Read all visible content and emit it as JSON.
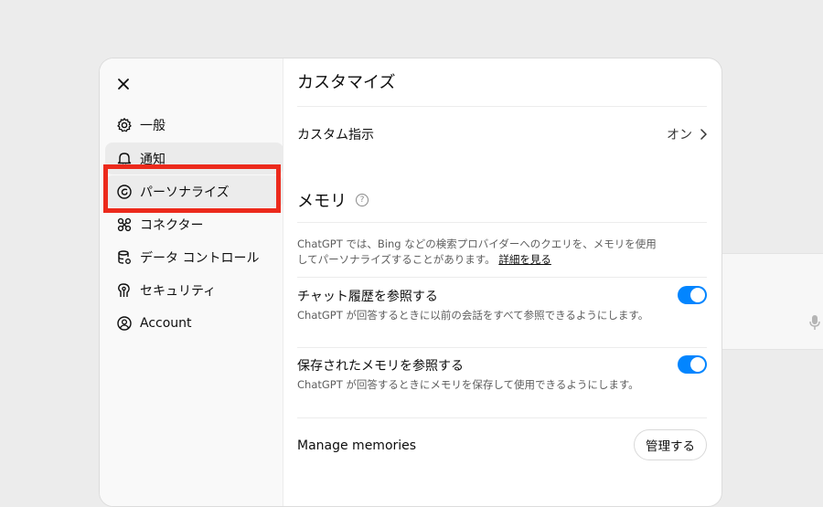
{
  "sidebar": {
    "items": [
      {
        "label": "一般",
        "icon": "gear-icon"
      },
      {
        "label": "通知",
        "icon": "bell-icon"
      },
      {
        "label": "パーソナライズ",
        "icon": "personalize-icon"
      },
      {
        "label": "コネクター",
        "icon": "connector-icon"
      },
      {
        "label": "データ コントロール",
        "icon": "database-icon"
      },
      {
        "label": "セキュリティ",
        "icon": "security-icon"
      },
      {
        "label": "Account",
        "icon": "account-icon"
      }
    ],
    "active_index": 2
  },
  "main": {
    "title": "カスタマイズ",
    "custom_instructions": {
      "label": "カスタム指示",
      "value": "オン"
    },
    "memory": {
      "title": "メモリ",
      "help": "?",
      "description": "ChatGPT では、Bing などの検索プロバイダーへのクエリを、メモリを使用してパーソナライズすることがあります。",
      "learn_more": "詳細を見る",
      "chat_history": {
        "label": "チャット履歴を参照する",
        "description": "ChatGPT が回答するときに以前の会話をすべて参照できるようにします。",
        "enabled": true
      },
      "saved_memory": {
        "label": "保存されたメモリを参照する",
        "description": "ChatGPT が回答するときにメモリを保存して使用できるようにします。",
        "enabled": true
      },
      "manage": {
        "label": "Manage memories",
        "button": "管理する"
      }
    }
  },
  "colors": {
    "accent": "#0285ff",
    "highlight": "#ec2a1c"
  }
}
